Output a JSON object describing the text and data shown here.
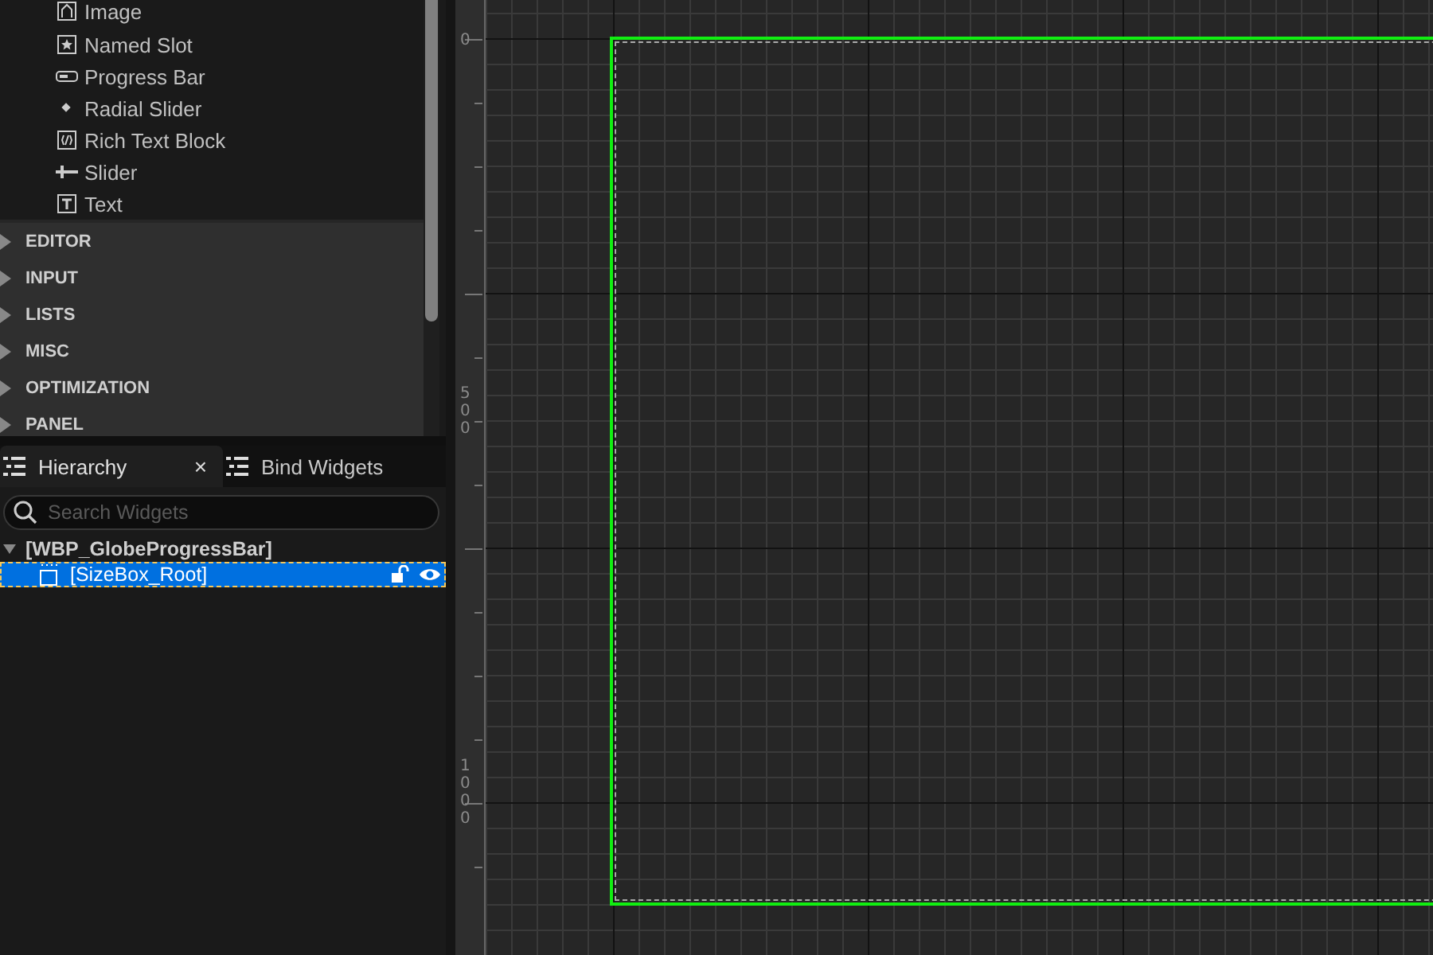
{
  "palette": {
    "items": [
      {
        "label": "Image",
        "kind": "image"
      },
      {
        "label": "Named Slot",
        "kind": "slot"
      },
      {
        "label": "Progress Bar",
        "kind": "bar"
      },
      {
        "label": "Radial Slider",
        "kind": "radial"
      },
      {
        "label": "Rich Text Block",
        "kind": "rich"
      },
      {
        "label": "Slider",
        "kind": "slider"
      },
      {
        "label": "Text",
        "kind": "text"
      }
    ],
    "categories": [
      {
        "label": "EDITOR",
        "expanded": false
      },
      {
        "label": "INPUT",
        "expanded": false
      },
      {
        "label": "LISTS",
        "expanded": false
      },
      {
        "label": "MISC",
        "expanded": false
      },
      {
        "label": "OPTIMIZATION",
        "expanded": false
      },
      {
        "label": "PANEL",
        "expanded": false
      }
    ]
  },
  "hierarchy": {
    "tabs": [
      {
        "label": "Hierarchy",
        "selected": true,
        "close": "×"
      },
      {
        "label": "Bind Widgets",
        "selected": false
      }
    ],
    "search": {
      "placeholder": "Search Widgets"
    },
    "tree": [
      {
        "label": "[WBP_GlobeProgressBar]",
        "expanded": true,
        "selected": false,
        "children": [
          {
            "label": "[SizeBox_Root]",
            "selected": true
          }
        ]
      }
    ]
  },
  "designer": {
    "ruler_labels": [
      "0",
      "500",
      "1000"
    ]
  }
}
